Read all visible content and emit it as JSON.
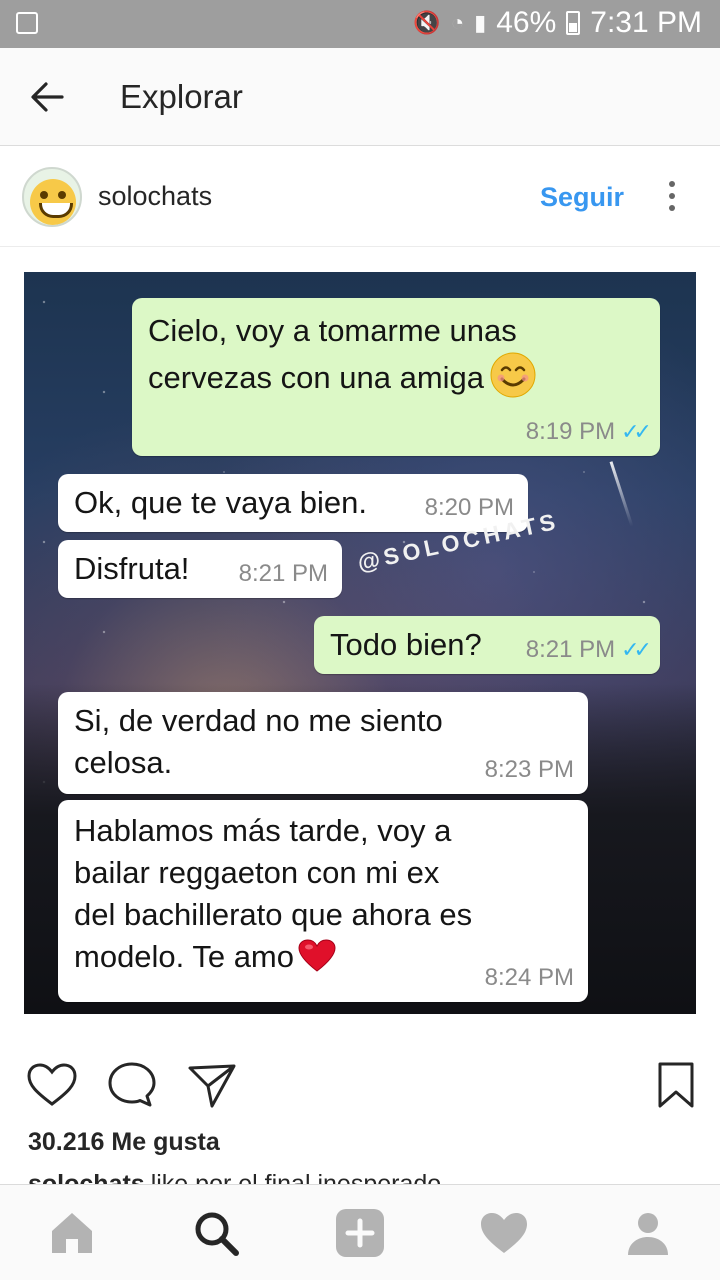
{
  "status_bar": {
    "battery": "46%",
    "time": "7:31 PM"
  },
  "header": {
    "title": "Explorar"
  },
  "post_header": {
    "username": "solochats",
    "follow_label": "Seguir"
  },
  "post": {
    "watermark": "@SOLOCHATS",
    "messages": [
      {
        "direction": "out",
        "lines": [
          "Cielo, voy a tomarme unas",
          "cervezas con una amiga"
        ],
        "emoji": "smiling-face",
        "time": "8:19 PM",
        "read": true
      },
      {
        "direction": "in",
        "lines": [
          "Ok, que te vaya bien."
        ],
        "time": "8:20 PM"
      },
      {
        "direction": "in",
        "lines": [
          "Disfruta!"
        ],
        "time": "8:21 PM"
      },
      {
        "direction": "out",
        "lines": [
          "Todo bien?"
        ],
        "time": "8:21 PM",
        "read": true
      },
      {
        "direction": "in",
        "lines": [
          "Si, de verdad no me siento",
          "celosa."
        ],
        "time": "8:23 PM"
      },
      {
        "direction": "in",
        "lines": [
          "Hablamos más tarde, voy a",
          "bailar reggaeton con mi ex",
          "del bachillerato que ahora es",
          "modelo. Te amo"
        ],
        "emoji": "red-heart",
        "time": "8:24 PM"
      }
    ]
  },
  "engagement": {
    "likes": "30.216 Me gusta",
    "caption_user": "solochats",
    "caption_text": "like por el final inesperado"
  },
  "icons": {
    "back": "arrow-left-icon",
    "more": "kebab-icon",
    "like": "heart-icon",
    "comment": "comment-icon",
    "share": "send-icon",
    "save": "bookmark-icon",
    "nav": [
      "home-icon",
      "search-icon",
      "add-icon",
      "activity-heart-icon",
      "profile-icon"
    ]
  },
  "colors": {
    "link": "#3897f0",
    "outgoing_bubble": "#dcf8c6",
    "incoming_bubble": "#ffffff",
    "status_bar": "#9e9e9e"
  }
}
